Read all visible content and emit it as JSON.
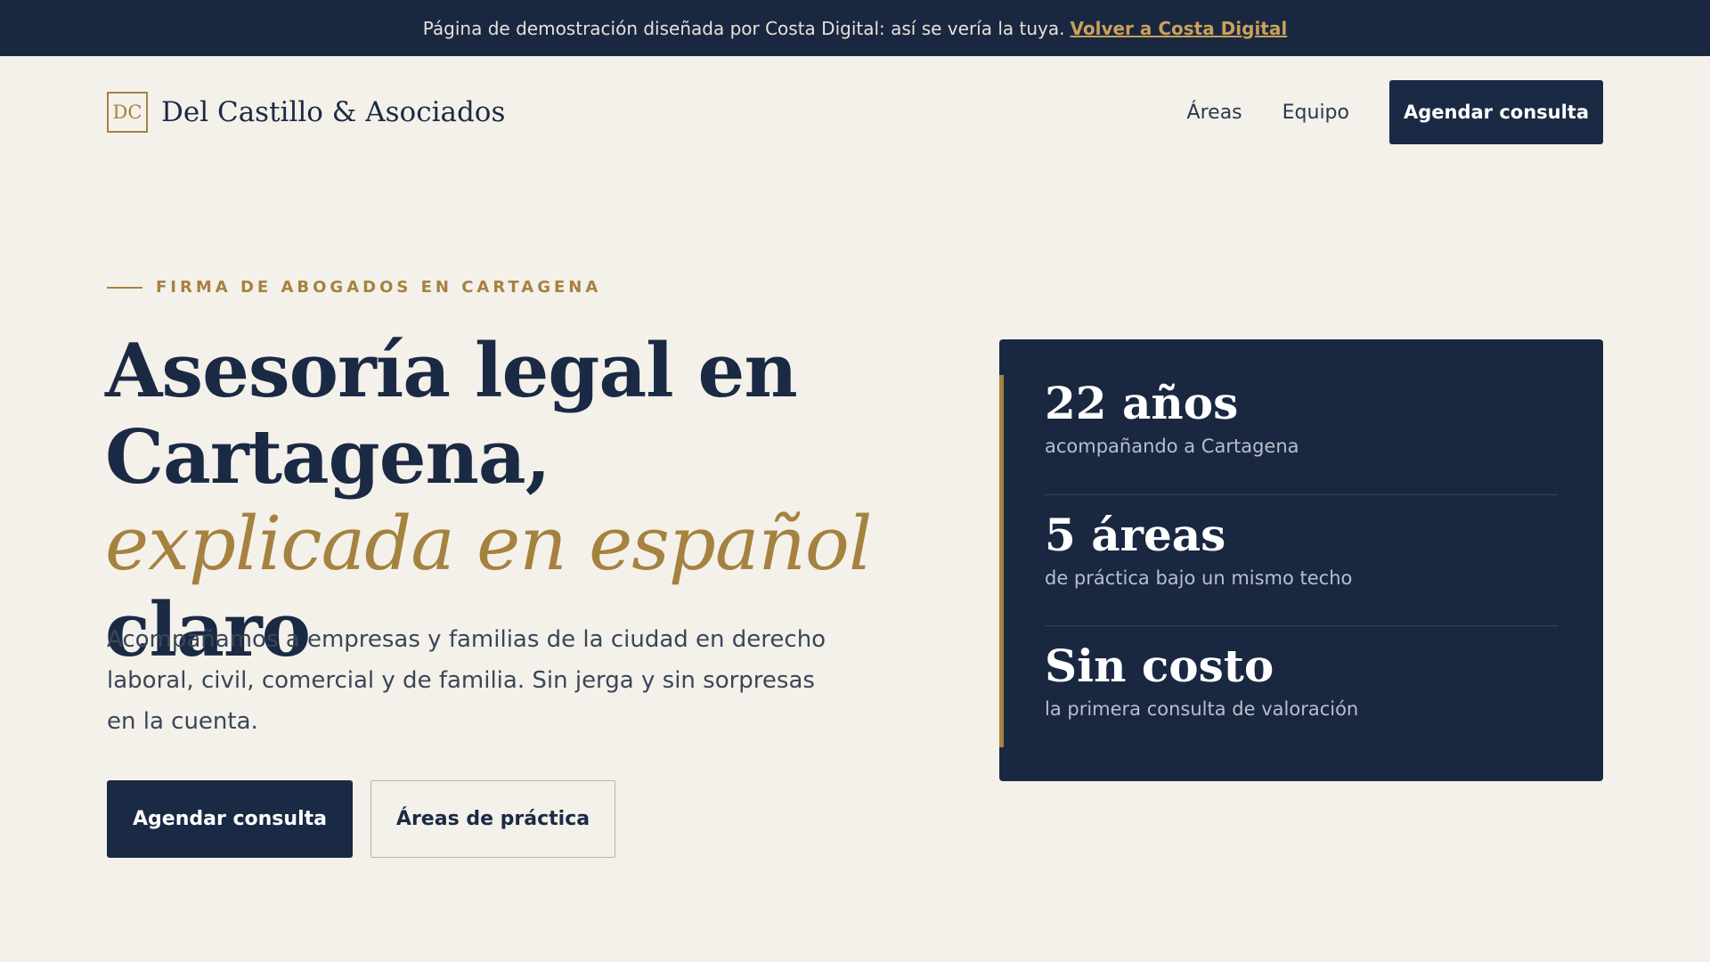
{
  "demo_bar": {
    "message": "Página de demostración diseñada por Costa Digital: así se vería la tuya.",
    "link": "Volver a Costa Digital"
  },
  "brand": {
    "logo_initials": "DC",
    "name": "Del Castillo & Asociados"
  },
  "nav": {
    "items": [
      "Áreas",
      "Equipo"
    ],
    "cta": "Agendar consulta"
  },
  "hero": {
    "eyebrow": "FIRMA DE ABOGADOS EN CARTAGENA",
    "headline": {
      "part1": "Asesoría legal en Cartagena,",
      "accent": "explicada en español",
      "part2": "claro"
    },
    "lead": "Acompañamos a empresas y familias de la ciudad en derecho laboral, civil, comercial y de familia. Sin jerga y sin sorpresas en la cuenta.",
    "primary_cta": "Agendar consulta",
    "secondary_cta": "Áreas de práctica"
  },
  "stats": [
    {
      "value": "22 años",
      "label": "acompañando a Cartagena"
    },
    {
      "value": "5 áreas",
      "label": "de práctica bajo un mismo techo"
    },
    {
      "value": "Sin costo",
      "label": "la primera consulta de valoración"
    }
  ],
  "colors": {
    "navy": "#1a2740",
    "gold": "#a5823f",
    "background": "#f4f1ea"
  }
}
